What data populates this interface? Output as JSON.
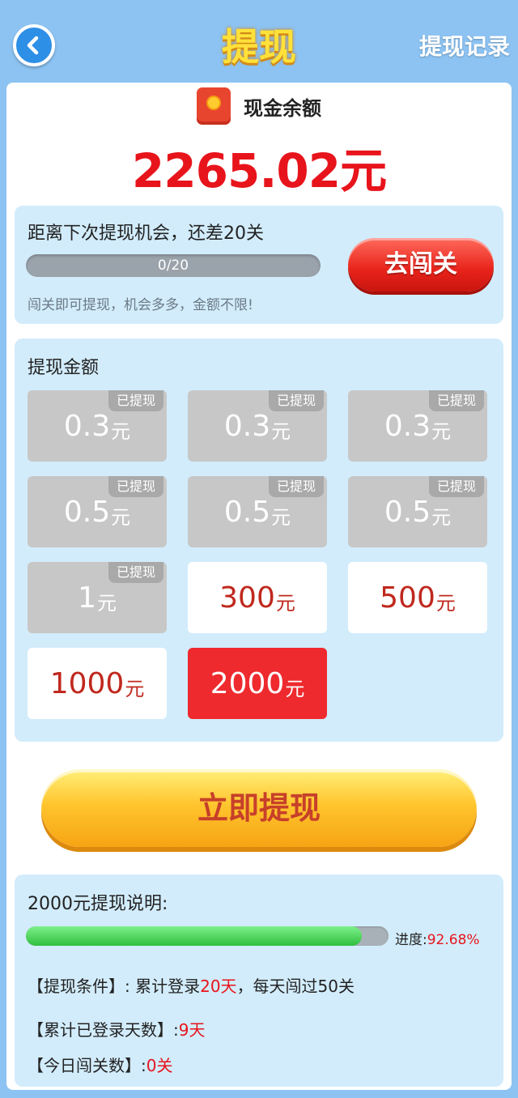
{
  "header": {
    "title": "提现",
    "record_label": "提现记录",
    "back_icon": "chevron-left-icon"
  },
  "balance": {
    "label": "现金余额",
    "amount": "2265.02元",
    "icon": "red-wallet-icon"
  },
  "chance": {
    "text": "距离下次提现机会，还差20关",
    "progress_text": "0/20",
    "progress": 0,
    "note": "闯关即可提现，机会多多，金额不限!",
    "go_button": "去闯关"
  },
  "amounts": {
    "title": "提现金额",
    "done_tag": "已提现",
    "options": [
      {
        "value": "0.3",
        "unit": "元",
        "status": "done"
      },
      {
        "value": "0.3",
        "unit": "元",
        "status": "done"
      },
      {
        "value": "0.3",
        "unit": "元",
        "status": "done"
      },
      {
        "value": "0.5",
        "unit": "元",
        "status": "done"
      },
      {
        "value": "0.5",
        "unit": "元",
        "status": "done"
      },
      {
        "value": "0.5",
        "unit": "元",
        "status": "done"
      },
      {
        "value": "1",
        "unit": "元",
        "status": "done"
      },
      {
        "value": "300",
        "unit": "元",
        "status": "available"
      },
      {
        "value": "500",
        "unit": "元",
        "status": "available"
      },
      {
        "value": "1000",
        "unit": "元",
        "status": "available"
      },
      {
        "value": "2000",
        "unit": "元",
        "status": "selected"
      }
    ]
  },
  "cashout_button": "立即提现",
  "explain": {
    "title": "2000元提现说明:",
    "progress_label": "进度:",
    "progress_value": "92.68%",
    "progress": 0.9268,
    "condition_label": "【提现条件】:",
    "condition_pre": "累计登录",
    "condition_days": "20天",
    "condition_post": "，每天闯过50关",
    "login_label": "【累计已登录天数】:",
    "login_value": "9天",
    "today_label": "【今日闯关数】:",
    "today_value": "0关"
  },
  "colors": {
    "background": "#8cc3f2",
    "accent_red": "#e8141c",
    "card_blue": "#d2ecfb",
    "button_yellow": "#ffc52e",
    "progress_green": "#48d05a"
  }
}
